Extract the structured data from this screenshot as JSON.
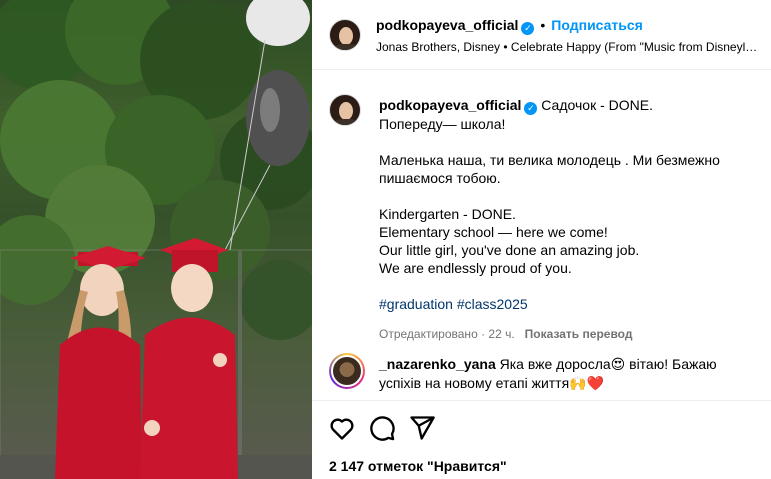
{
  "post": {
    "username": "podkopayeva_official",
    "verified_mark": "✓",
    "dot": "•",
    "follow_label": "Подписаться",
    "music": "Jonas Brothers, Disney • Celebrate Happy (From \"Music from Disneyland Resort\")"
  },
  "caption": {
    "username": "podkopayeva_official",
    "lines": [
      "Садочок - DONE.",
      "Попереду— школа!",
      "",
      "Маленька наша, ти велика молодець . Ми безмежно пишаємося тобою.",
      "",
      "Kindergarten - DONE.",
      "Elementary school — here we come!",
      "Our little girl, you've done an amazing job.",
      "We are endlessly proud of you.",
      "",
      "#graduation #class2025"
    ],
    "edited_label": "Отредактировано · 22 ч.",
    "translate_label": "Показать перевод"
  },
  "comment": {
    "username": "_nazarenko_yana",
    "text": "Яка вже доросла😍 вітаю! Бажаю успіхів на новому етапі життя🙌❤️"
  },
  "actions": {
    "like_icon": "heart-icon",
    "comment_icon": "comment-icon",
    "share_icon": "send-icon"
  },
  "likes_text": "2 147 отметок \"Нравится\"",
  "colors": {
    "accent": "#0095f6",
    "hashtag": "#00376b",
    "muted": "#737373"
  }
}
